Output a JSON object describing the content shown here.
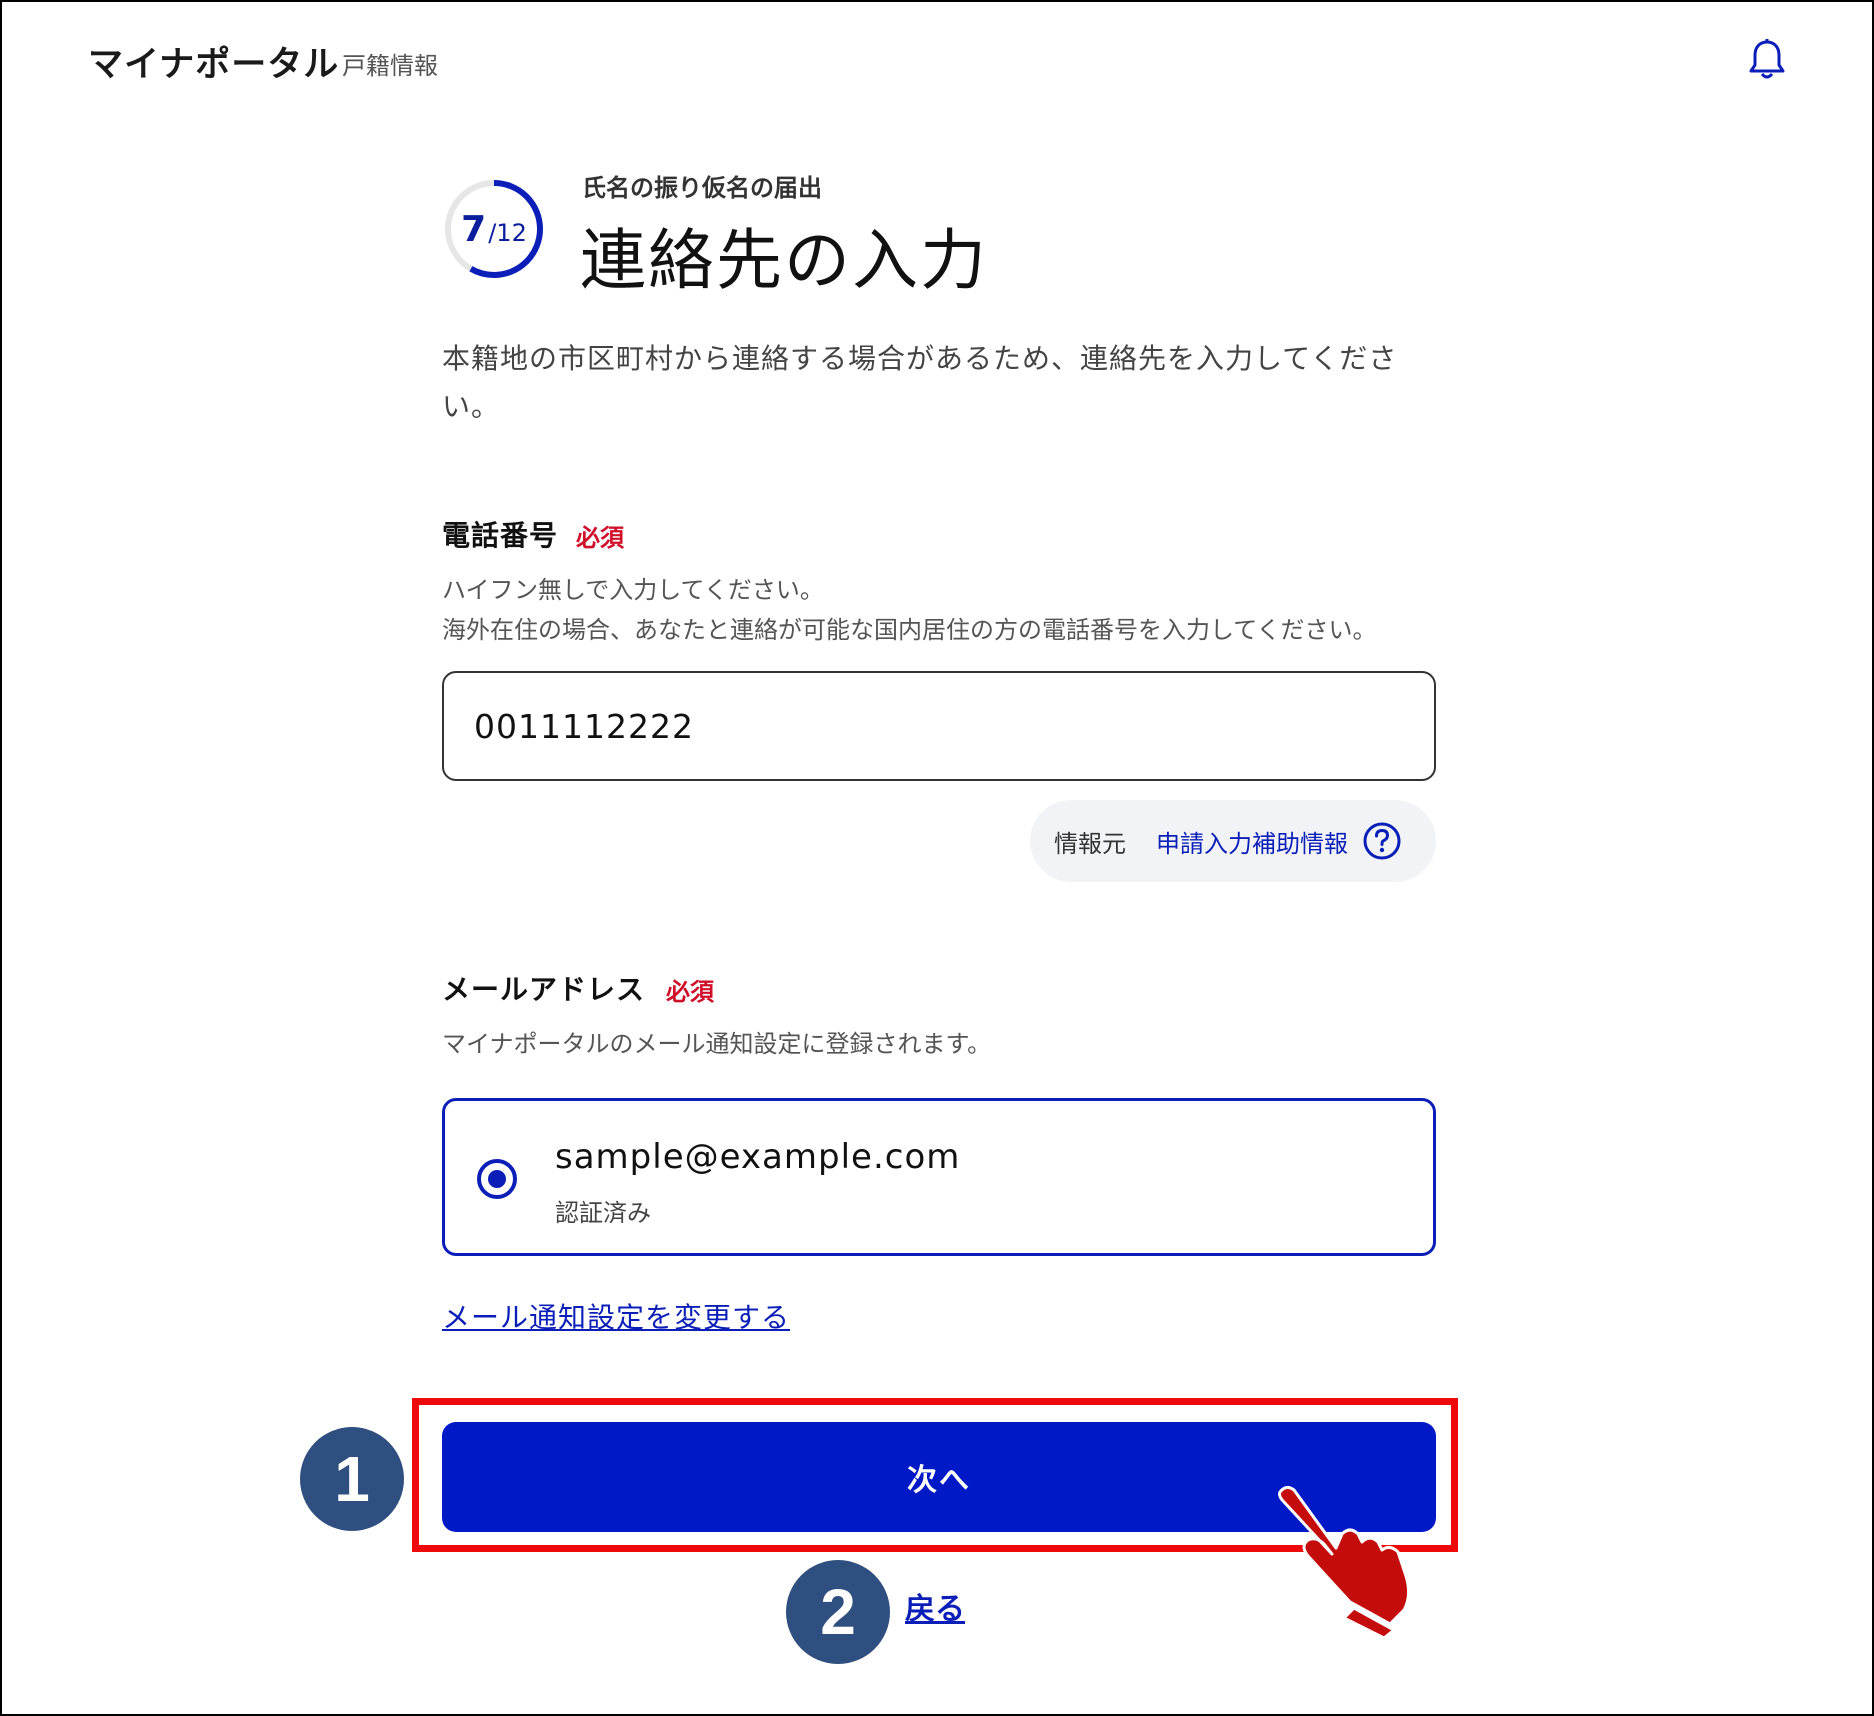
{
  "header": {
    "app_title": "マイナポータル",
    "app_subtitle": "戸籍情報",
    "bell_icon": "bell-icon"
  },
  "progress": {
    "current": "7",
    "total": "/12",
    "fraction": 0.583
  },
  "page": {
    "procedure_name": "氏名の振り仮名の届出",
    "title": "連絡先の入力",
    "lead_line1": "本籍地の市区町村から連絡する場合があるため、連絡先を入力してくださ",
    "lead_line2": "い。"
  },
  "phone": {
    "label": "電話番号",
    "required": "必須",
    "hint_line1": "ハイフン無しで入力してください。",
    "hint_line2": "海外在住の場合、あなたと連絡が可能な国内居住の方の電話番号を入力してください。",
    "value": "0011112222"
  },
  "source": {
    "label": "情報元",
    "link": "申請入力補助情報",
    "help_icon": "question-circle-icon"
  },
  "email": {
    "label": "メールアドレス",
    "required": "必須",
    "hint": "マイナポータルのメール通知設定に登録されます。",
    "value": "sample@example.com",
    "status": "認証済み",
    "change_link": "メール通知設定を変更する"
  },
  "actions": {
    "next": "次へ",
    "back": "戻る"
  },
  "annotations": {
    "step1": "1",
    "step2": "2",
    "highlight_color": "#ee0a0a",
    "badge_color": "#2e4f80",
    "pointer_icon": "pointing-hand-icon"
  },
  "colors": {
    "primary": "#0019c6",
    "link": "#0b1fb8",
    "required": "#d0102a"
  }
}
